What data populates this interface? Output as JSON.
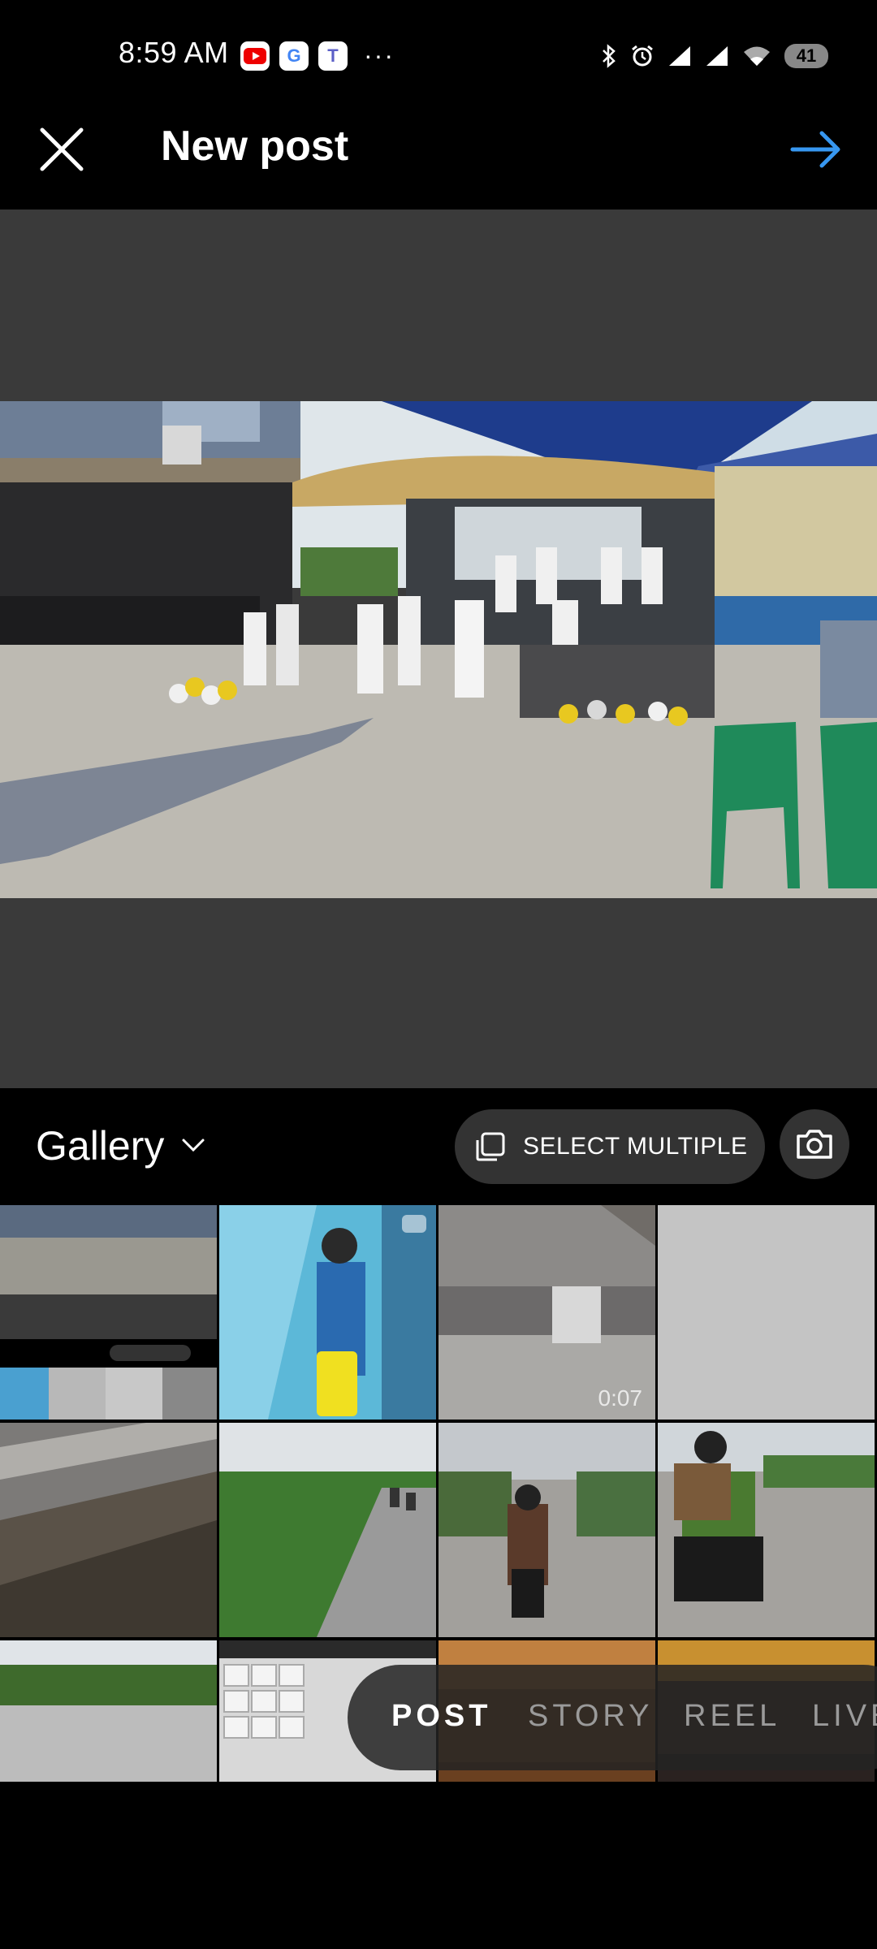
{
  "status_bar": {
    "time": "8:59 AM",
    "notification_icons": [
      "youtube-icon",
      "google-icon",
      "teams-icon"
    ],
    "overflow": "···",
    "battery": "41"
  },
  "header": {
    "title": "New post",
    "close_icon": "close-icon",
    "next_icon": "arrow-right-icon",
    "accent_color": "#3797f0"
  },
  "gallery": {
    "source_label": "Gallery",
    "select_multiple_label": "SELECT MULTIPLE"
  },
  "thumbnails": [
    {
      "name": "thumb-screenshot"
    },
    {
      "name": "thumb-airport-traveler",
      "badge": "multi"
    },
    {
      "name": "thumb-event-video",
      "duration": "0:07"
    },
    {
      "name": "thumb-blank"
    },
    {
      "name": "thumb-floor"
    },
    {
      "name": "thumb-road-motorbikes"
    },
    {
      "name": "thumb-motorbike-rider"
    },
    {
      "name": "thumb-motorbike-backpack"
    },
    {
      "name": "thumb-palm-road"
    },
    {
      "name": "thumb-keyboard"
    },
    {
      "name": "thumb-interior"
    },
    {
      "name": "thumb-dark"
    }
  ],
  "modes": [
    "POST",
    "STORY",
    "REEL",
    "LIVE"
  ],
  "active_mode": "POST"
}
